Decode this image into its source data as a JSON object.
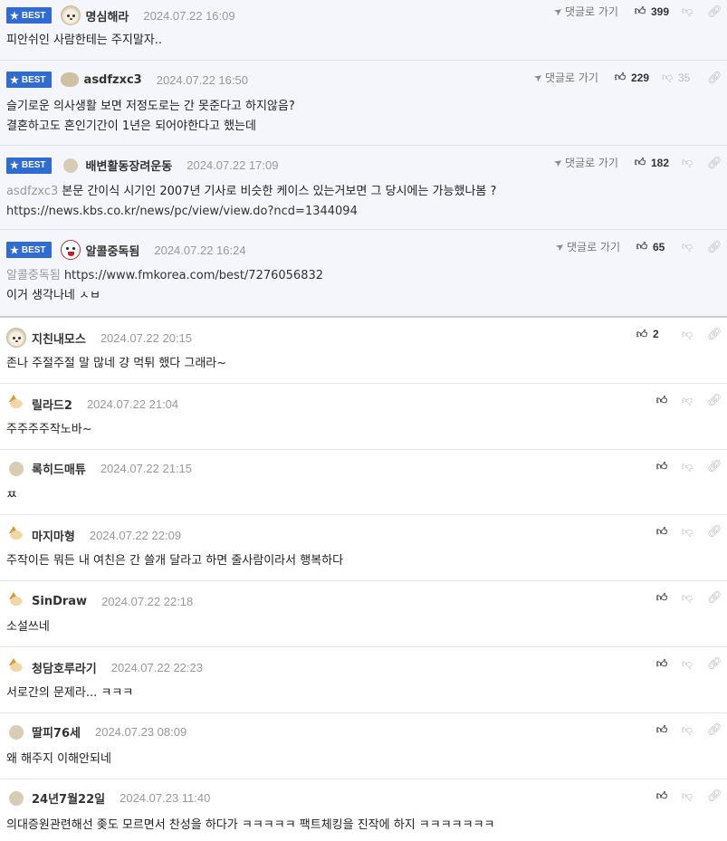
{
  "ui": {
    "best_label": "BEST",
    "reply_label": "댓글로 가기",
    "icons": {
      "star": "star-icon",
      "reply": "send-arrow-icon",
      "upvote": "thumbs-up-icon",
      "downvote": "thumbs-down-icon",
      "link": "link-icon"
    },
    "colors": {
      "badge": "#2f6bd0",
      "best_bg": "#f4f6fb"
    }
  },
  "best_comments": [
    {
      "author": "명심해라",
      "date": "2024.07.22 16:09",
      "upvotes": "399",
      "downvotes": "",
      "mention": "",
      "lines": [
        "피안쉬인 사람한테는 주지말자.."
      ]
    },
    {
      "author": "asdfzxc3",
      "date": "2024.07.22 16:50",
      "upvotes": "229",
      "downvotes": "35",
      "mention": "",
      "lines": [
        "슬기로운 의사생활 보면 저정도로는 간 못준다고 하지않음?",
        "결혼하고도 혼인기간이 1년은 되어야한다고 했는데"
      ]
    },
    {
      "author": "배변활동장려운동",
      "date": "2024.07.22 17:09",
      "upvotes": "182",
      "downvotes": "",
      "mention": "asdfzxc3",
      "lines": [
        "본문 간이식 시기인 2007년 기사로 비슷한 케이스 있는거보면 그 당시에는 가능했나봄 ?",
        "https://news.kbs.co.kr/news/pc/view/view.do?ncd=1344094"
      ]
    },
    {
      "author": "알콜중독됨",
      "date": "2024.07.22 16:24",
      "upvotes": "65",
      "downvotes": "",
      "mention": "알콜중독됨",
      "lines": [
        "https://www.fmkorea.com/best/7276056832",
        "이거 생각나네 ㅅㅂ"
      ]
    }
  ],
  "comments": [
    {
      "author": "지친내모스",
      "date": "2024.07.22 20:15",
      "upvotes": "2",
      "text": "존나 주절주절 말 많네 걍 먹튀 했다 그래라~"
    },
    {
      "author": "릴라드2",
      "date": "2024.07.22 21:04",
      "upvotes": "",
      "text": "주주주주작노바~"
    },
    {
      "author": "록히드매튜",
      "date": "2024.07.22 21:15",
      "upvotes": "",
      "text": "ㅉ"
    },
    {
      "author": "마지마형",
      "date": "2024.07.22 22:09",
      "upvotes": "",
      "text": "주작이든 뭐든 내 여친은 간 쓸개 달라고 하면 줄사람이라서 행복하다"
    },
    {
      "author": "SinDraw",
      "date": "2024.07.22 22:18",
      "upvotes": "",
      "text": "소설쓰네"
    },
    {
      "author": "청담호루라기",
      "date": "2024.07.22 22:23",
      "upvotes": "",
      "text": "서로간의 문제라... ㅋㅋㅋ"
    },
    {
      "author": "딸피76세",
      "date": "2024.07.23 08:09",
      "upvotes": "",
      "text": "왜 해주지 이해안되네"
    },
    {
      "author": "24년7월22일",
      "date": "2024.07.23 11:40",
      "upvotes": "",
      "text": "의대증원관련해선 좆도 모르면서 찬성을 하다가 ㅋㅋㅋㅋㅋ 팩트체킹을 진작에 하지 ㅋㅋㅋㅋㅋㅋㅋ"
    }
  ]
}
